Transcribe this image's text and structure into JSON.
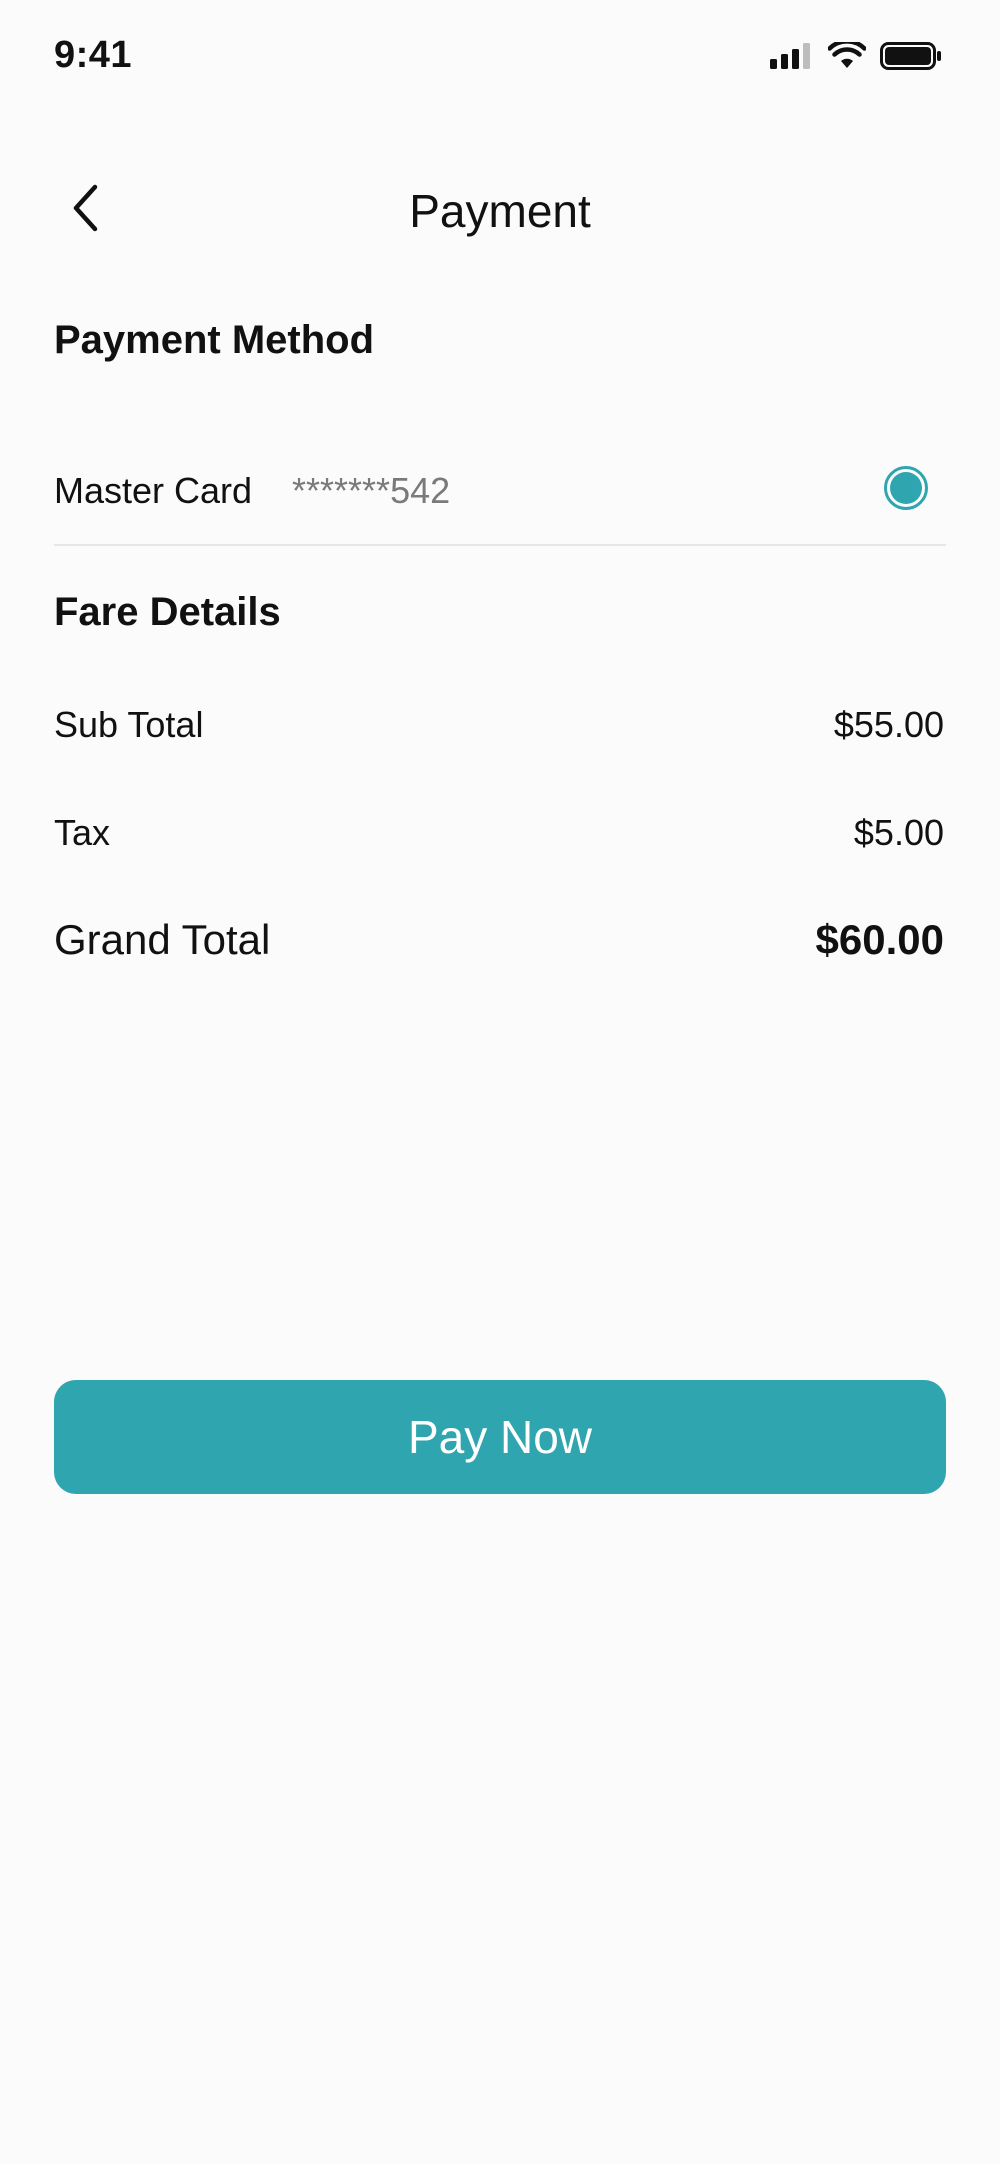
{
  "status_bar": {
    "time": "9:41",
    "icons": [
      "signal-icon",
      "wifi-icon",
      "battery-icon"
    ]
  },
  "header": {
    "back_icon": "chevron-left-icon",
    "title": "Payment"
  },
  "payment_method": {
    "title": "Payment Method",
    "card_name": "Master Card",
    "card_number": "*******542",
    "selected": true
  },
  "fare_details": {
    "title": "Fare Details",
    "sub_total_label": "Sub Total",
    "sub_total_value": "$55.00",
    "tax_label": "Tax",
    "tax_value": "$5.00",
    "grand_total_label": "Grand Total",
    "grand_total_value": "$60.00"
  },
  "actions": {
    "pay_now_label": "Pay Now"
  },
  "colors": {
    "accent": "#2fa5b0",
    "background": "#fbfbfb",
    "text": "#111111",
    "muted_text": "#7a7a7a",
    "divider": "#e6e6e6"
  }
}
